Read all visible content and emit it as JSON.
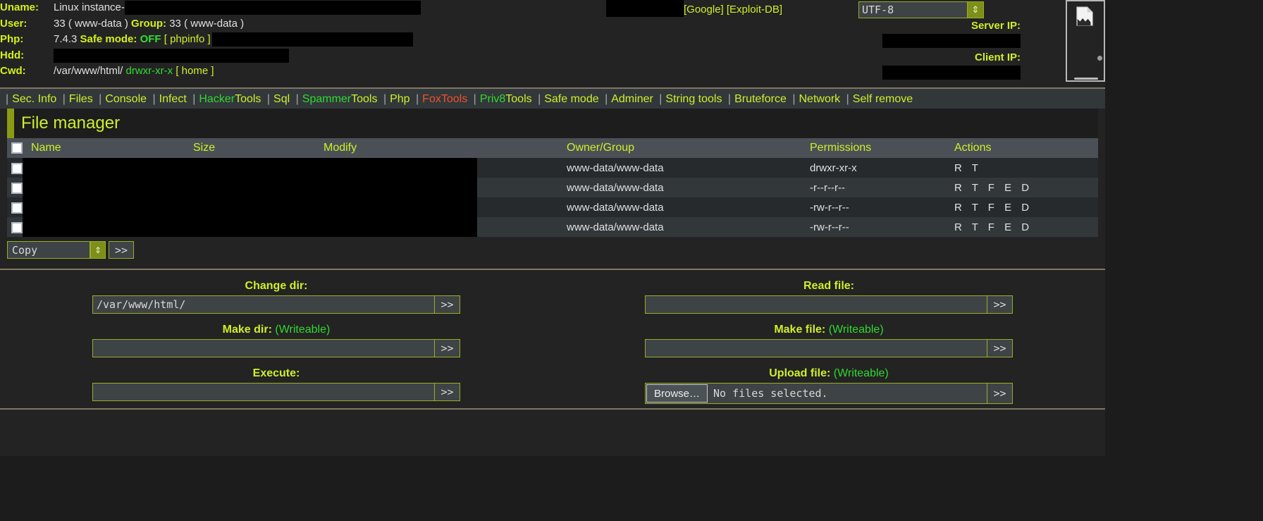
{
  "header": {
    "rows": [
      {
        "label": "Uname:",
        "value": "Linux instance-",
        "redacted_width": 420
      },
      {
        "label": "User:",
        "value": "33 ( www-data )",
        "bold_label2": "Group:",
        "value2": "33 ( www-data )"
      },
      {
        "label": "Php:",
        "value": "7.4.3",
        "bold_label2": "Safe mode:",
        "safe_mode": "OFF",
        "phpinfo": "[ phpinfo ]",
        "redacted_width": 285
      },
      {
        "label": "Hdd:",
        "value": "",
        "redacted_width": 334
      },
      {
        "label": "Cwd:",
        "value": "/var/www/html/",
        "perm": "drwxr-xr-x",
        "home": "[ home ]"
      }
    ],
    "top_links": "[Google] [Exploit-DB]",
    "encoding": {
      "value": "UTF-8",
      "arrow": "⇕"
    },
    "server_ip_label": "Server IP:",
    "client_ip_label": "Client IP:",
    "corner_icon": "broken-image-icon"
  },
  "nav": {
    "items": [
      {
        "label": "Sec. Info",
        "style": "lime"
      },
      {
        "label": "Files",
        "style": "lime"
      },
      {
        "label": "Console",
        "style": "lime"
      },
      {
        "label": "Infect",
        "style": "lime"
      },
      {
        "label": "HackerTools",
        "style": "split",
        "green_part": "Hacker",
        "lime_part": "Tools"
      },
      {
        "label": "Sql",
        "style": "lime"
      },
      {
        "label": "SpammerTools",
        "style": "split",
        "green_part": "Spammer",
        "lime_part": "Tools"
      },
      {
        "label": "Php",
        "style": "lime"
      },
      {
        "label": "FoxTools",
        "style": "orange"
      },
      {
        "label": "Priv8Tools",
        "style": "split",
        "green_part": "Priv8",
        "lime_part": "Tools"
      },
      {
        "label": "Safe mode",
        "style": "lime"
      },
      {
        "label": "Adminer",
        "style": "lime"
      },
      {
        "label": "String tools",
        "style": "lime"
      },
      {
        "label": "Bruteforce",
        "style": "lime"
      },
      {
        "label": "Network",
        "style": "lime"
      },
      {
        "label": "Self remove",
        "style": "lime"
      }
    ],
    "separator": "|"
  },
  "panel": {
    "title": "File manager"
  },
  "file_table": {
    "columns": [
      "Name",
      "Size",
      "Modify",
      "Owner/Group",
      "Permissions",
      "Actions"
    ],
    "rows": [
      {
        "name": "",
        "size": "",
        "modify": "",
        "owner": "www-data/www-data",
        "permissions": "drwxr-xr-x",
        "perm_color": "green",
        "actions": "R T",
        "redacted_width": 645
      },
      {
        "name": "",
        "size": "",
        "modify": "",
        "owner": "www-data/www-data",
        "permissions": "-r--r--r--",
        "perm_color": "white",
        "actions": "R T F E D",
        "redacted_width": 645
      },
      {
        "name": "",
        "size": "",
        "modify": "",
        "owner": "www-data/www-data",
        "permissions": "-rw-r--r--",
        "perm_color": "green",
        "actions": "R T F E D",
        "redacted_width": 645
      },
      {
        "name": "",
        "size": "",
        "modify": "",
        "owner": "www-data/www-data",
        "permissions": "-rw-r--r--",
        "perm_color": "green",
        "actions": "R T F E D",
        "redacted_width": 645
      }
    ]
  },
  "bulk_action": {
    "selected": "Copy",
    "arrow": "⇕",
    "submit": ">>"
  },
  "forms": {
    "left": [
      {
        "label": "Change dir:",
        "writeable": "",
        "value": "/var/www/html/",
        "placeholder": "",
        "submit": ">>",
        "name": "change-dir"
      },
      {
        "label": "Make dir:",
        "writeable": "(Writeable)",
        "value": "",
        "placeholder": "",
        "submit": ">>",
        "name": "make-dir"
      },
      {
        "label": "Execute:",
        "writeable": "",
        "value": "",
        "placeholder": "",
        "submit": ">>",
        "name": "execute"
      }
    ],
    "right": [
      {
        "label": "Read file:",
        "writeable": "",
        "value": "",
        "placeholder": "",
        "submit": ">>",
        "name": "read-file"
      },
      {
        "label": "Make file:",
        "writeable": "(Writeable)",
        "value": "",
        "placeholder": "",
        "submit": ">>",
        "name": "make-file"
      }
    ],
    "upload": {
      "label": "Upload file:",
      "writeable": "(Writeable)",
      "browse": "Browse…",
      "status": "No files selected.",
      "submit": ">>",
      "name": "upload-file"
    }
  },
  "colors": {
    "accent_lime": "#cdf02a",
    "accent_green": "#2fd92f",
    "accent_orange": "#f0522a",
    "bg_dark": "#232323",
    "bg_row_odd": "#262a2c",
    "bg_row_even": "#32373a",
    "header_row": "#4a5055",
    "rule": "#7e7763"
  }
}
